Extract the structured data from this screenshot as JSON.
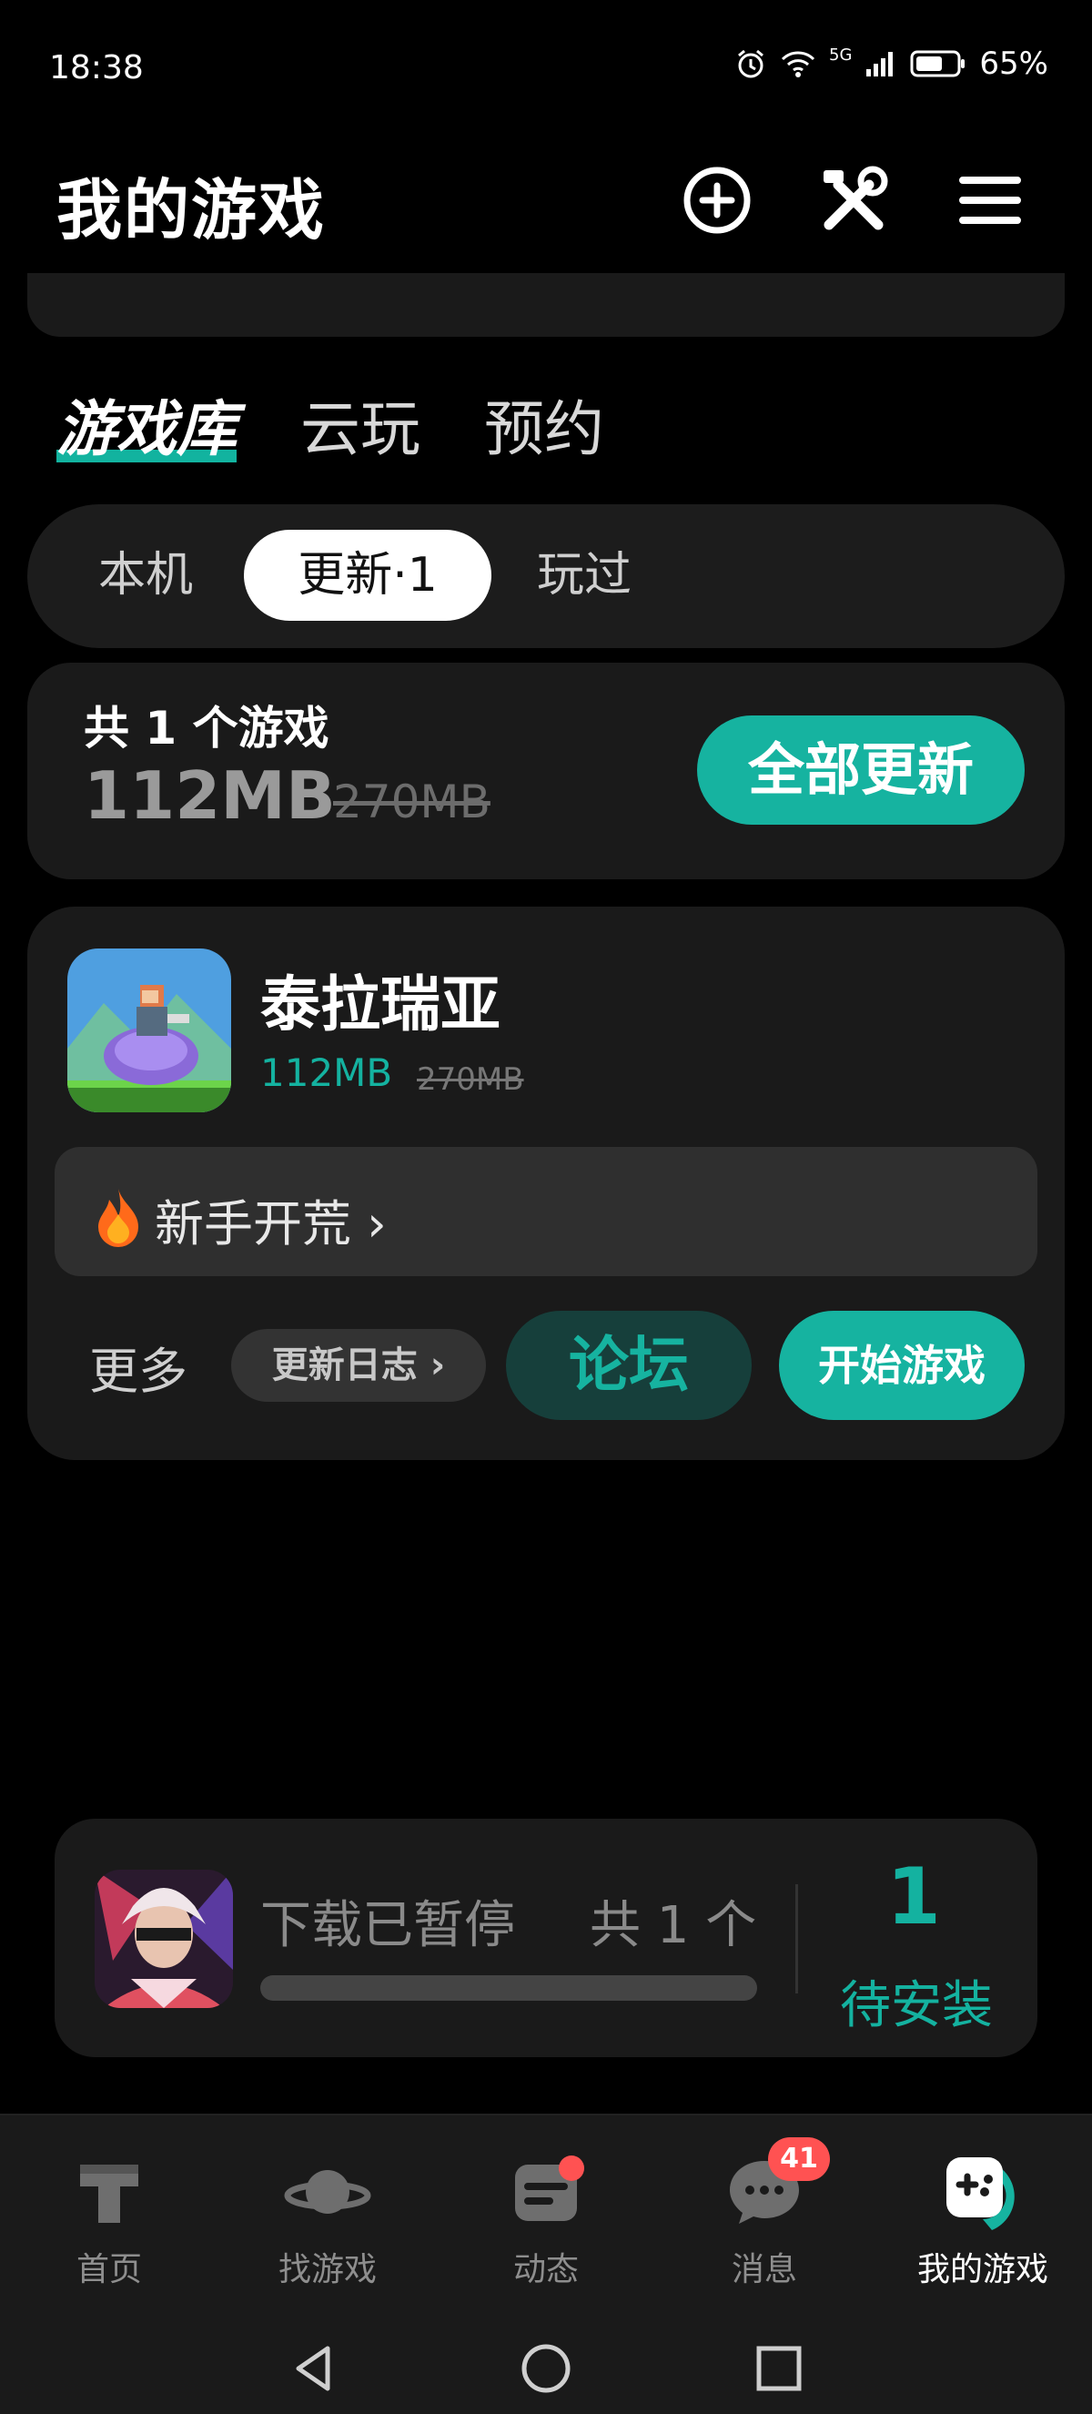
{
  "status_bar": {
    "time": "18:38",
    "network": "5G",
    "battery": "65%"
  },
  "header": {
    "title": "我的游戏",
    "icons": [
      "add-circle-icon",
      "tools-icon",
      "menu-icon"
    ]
  },
  "main_tabs": [
    {
      "label": "游戏库",
      "active": true
    },
    {
      "label": "云玩",
      "active": false
    },
    {
      "label": "预约",
      "active": false
    }
  ],
  "segment_tabs": [
    {
      "label": "本机",
      "active": false
    },
    {
      "label": "更新·1",
      "active": true
    },
    {
      "label": "玩过",
      "active": false
    }
  ],
  "summary": {
    "count_text": "共 1 个游戏",
    "update_size": "112MB",
    "original_size": "270MB",
    "update_all_label": "全部更新"
  },
  "game": {
    "name": "泰拉瑞亚",
    "update_size": "112MB",
    "original_size": "270MB",
    "tip": "新手开荒",
    "more_label": "更多",
    "changelog_label": "更新日志",
    "forum_label": "论坛",
    "start_label": "开始游戏"
  },
  "download": {
    "status": "下载已暂停",
    "total": "共 1 个",
    "pending_count": "1",
    "pending_label": "待安装",
    "progress": 0.0
  },
  "bottom_nav": [
    {
      "label": "首页",
      "icon": "home-icon",
      "active": false
    },
    {
      "label": "找游戏",
      "icon": "planet-icon",
      "active": false
    },
    {
      "label": "动态",
      "icon": "feed-icon",
      "active": false,
      "dot": true
    },
    {
      "label": "消息",
      "icon": "chat-icon",
      "active": false,
      "badge": "41"
    },
    {
      "label": "我的游戏",
      "icon": "gamepad-icon",
      "active": true
    }
  ],
  "colors": {
    "accent": "#16b3a0",
    "background": "#000000",
    "card": "#1a1a1a",
    "badge": "#ff5252"
  }
}
